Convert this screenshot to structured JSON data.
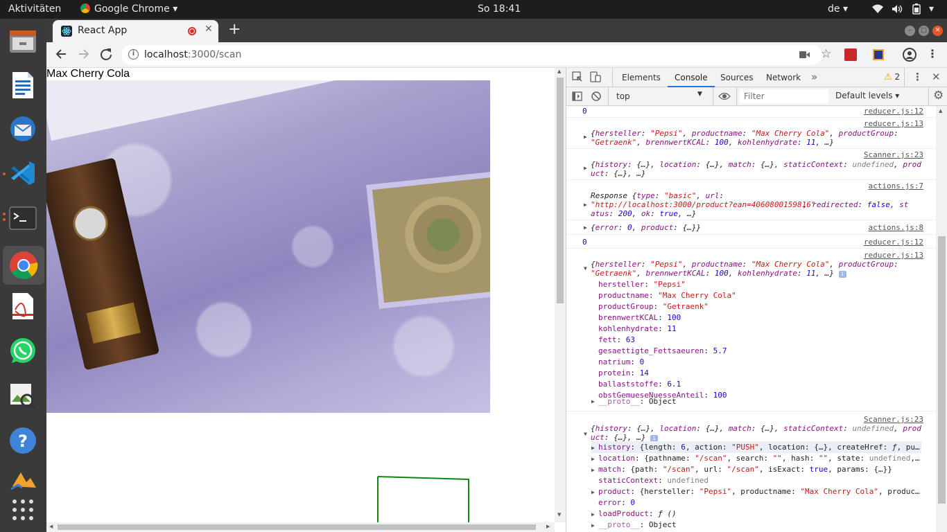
{
  "topbar": {
    "activities": "Aktivitäten",
    "app": "Google Chrome",
    "clock": "So 18:41",
    "lang": "de"
  },
  "dock": {
    "items": [
      "files-icon",
      "writer-icon",
      "thunderbird-icon",
      "vscode-icon",
      "terminal-icon",
      "chrome-icon",
      "pdf-icon",
      "whatsapp-icon",
      "image-viewer-icon",
      "help-icon",
      "software-icon",
      "apps-grid-icon"
    ]
  },
  "browser": {
    "tab_title": "React App",
    "url_host": "localhost",
    "url_path": ":3000/scan"
  },
  "page": {
    "product_title": "Max Cherry Cola"
  },
  "devtools": {
    "tabs": [
      "Elements",
      "Console",
      "Sources",
      "Network"
    ],
    "active_tab": "Console",
    "warning_count": "2",
    "context": "top",
    "filter_placeholder": "Filter",
    "levels": "Default levels"
  },
  "console": {
    "m1": {
      "src": "reducer.js:12",
      "val": "0"
    },
    "m2": {
      "src": "reducer.js:13"
    },
    "m3": {
      "src": "Scanner.js:23"
    },
    "m4": {
      "src": "actions.js:7",
      "url": "\"http://localhost:3000/product?ean=4060800159816\""
    },
    "m5": {
      "src": "actions.js:8"
    },
    "m6": {
      "src": "reducer.js:12",
      "val": "0"
    },
    "m7": {
      "src": "reducer.js:13",
      "props": [
        [
          "hersteller",
          "\"Pepsi\""
        ],
        [
          "productname",
          "\"Max Cherry Cola\""
        ],
        [
          "productGroup",
          "\"Getraenk\""
        ],
        [
          "brennwertKCAL",
          "100"
        ],
        [
          "kohlenhydrate",
          "11"
        ],
        [
          "fett",
          "63"
        ],
        [
          "gesaettigte_Fettsaeuren",
          "5.7"
        ],
        [
          "natrium",
          "0"
        ],
        [
          "protein",
          "14"
        ],
        [
          "ballaststoffe",
          "6.1"
        ],
        [
          "obstGemueseNuesseAnteil",
          "100"
        ]
      ]
    },
    "m8": {
      "src": "Scanner.js:23"
    }
  }
}
